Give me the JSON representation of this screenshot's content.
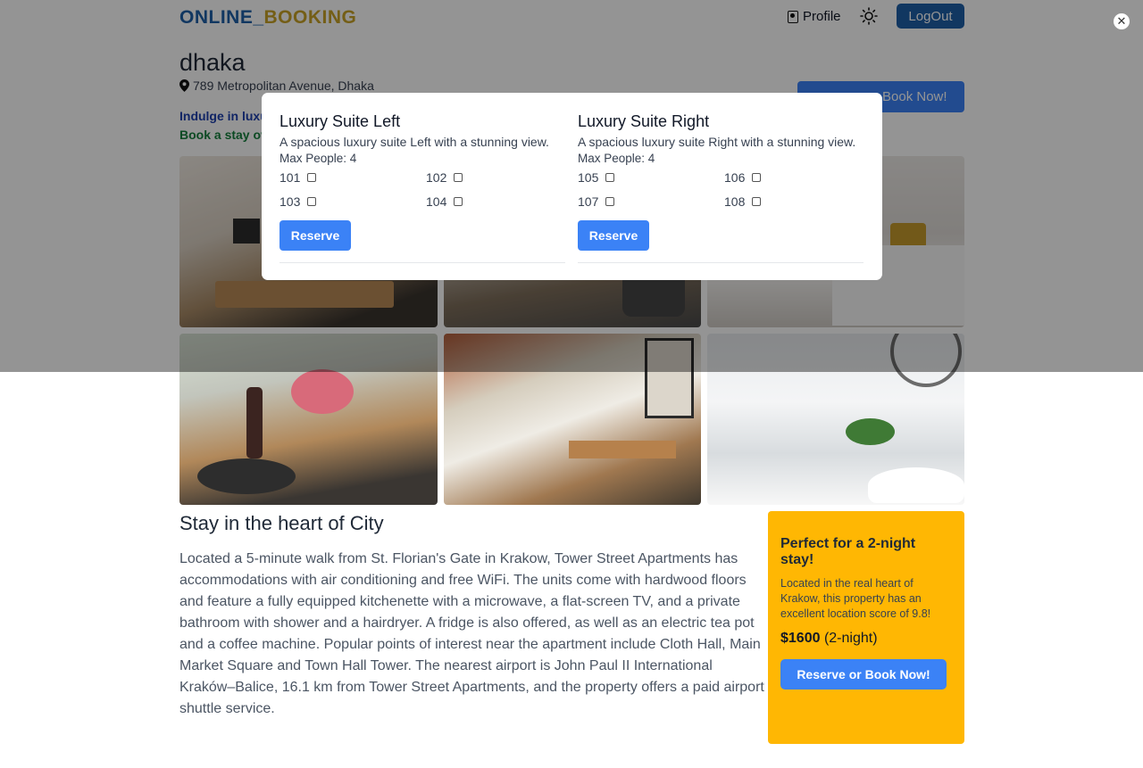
{
  "header": {
    "logo_part1": "ONLINE_",
    "logo_part2": "BOOKING",
    "profile_label": "Profile",
    "logout_label": "LogOut"
  },
  "hotel": {
    "name": "dhaka",
    "address": "789 Metropolitan Avenue, Dhaka",
    "tagline1": "Indulge in luxu",
    "tagline2": "Book a stay ov",
    "book_now_label": "Book Now!"
  },
  "description": {
    "title": "Stay in the heart of City",
    "body": "Located a 5-minute walk from St. Florian's Gate in Krakow, Tower Street Apartments has accommodations with air conditioning and free WiFi. The units come with hardwood floors and feature a fully equipped kitchenette with a microwave, a flat-screen TV, and a private bathroom with shower and a hairdryer. A fridge is also offered, as well as an electric tea pot and a coffee machine. Popular points of interest near the apartment include Cloth Hall, Main Market Square and Town Hall Tower. The nearest airport is John Paul II International Kraków–Balice, 16.1 km from Tower Street Apartments, and the property offers a paid airport shuttle service."
  },
  "offer": {
    "title": "Perfect for a 2-night stay!",
    "text": "Located in the real heart of Krakow, this property has an excellent location score of 9.8!",
    "price": "$1600",
    "price_suffix": "(2-night)",
    "button_label": "Reserve or Book Now!"
  },
  "modal": {
    "close_symbol": "✕",
    "suites": [
      {
        "title": "Luxury Suite Left",
        "description": "A spacious luxury suite Left with a stunning view.",
        "max_people": "Max People: 4",
        "rooms": [
          "101",
          "102",
          "103",
          "104"
        ],
        "reserve_label": "Reserve"
      },
      {
        "title": "Luxury Suite Right",
        "description": "A spacious luxury suite Right with a stunning view.",
        "max_people": "Max People: 4",
        "rooms": [
          "105",
          "106",
          "107",
          "108"
        ],
        "reserve_label": "Reserve"
      }
    ]
  },
  "colors": {
    "brand_blue": "#1e5fa8",
    "brand_gold": "#c9a227",
    "accent_blue": "#3b82f6",
    "offer_yellow": "#ffb703"
  },
  "icons": [
    "profile-icon",
    "sun-icon",
    "location-pin-icon",
    "close-icon"
  ]
}
